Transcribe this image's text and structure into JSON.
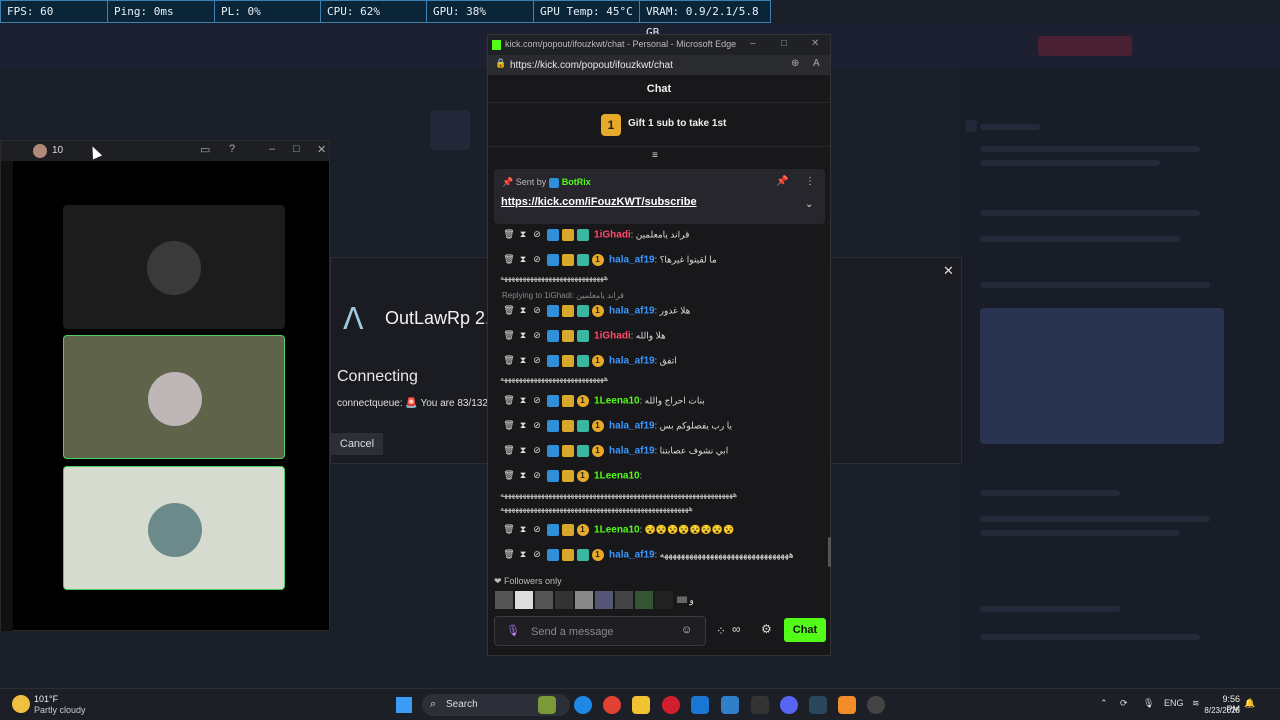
{
  "stats": [
    "FPS: 60",
    "Ping: 0ms",
    "PL: 0%",
    "CPU: 62%",
    "GPU: 38%",
    "GPU Temp: 45°C",
    "VRAM: 0.9/2.1/5.8 GB"
  ],
  "voice": {
    "title": "10"
  },
  "dialog": {
    "title": "OutLawRp 2.",
    "status": "Connecting",
    "queue": "connectqueue: 🚨 You are 83/132",
    "cancel": "Cancel",
    "close": "✕"
  },
  "edge": {
    "window_title": "kick.com/popout/ifouzkwt/chat - Personal - Microsoft Edge",
    "url": "https://kick.com/popout/ifouzkwt/chat",
    "chat_header": "Chat",
    "gift_badge": "1",
    "gift_text": "Gift 1 sub to take 1st",
    "pinned": {
      "sent_by": "Sent by",
      "user": "BotRix",
      "link": "https://kick.com/iFouzKWT/subscribe"
    },
    "messages": [
      {
        "user": "1iGhadi",
        "text": ": قراند يامعلمين"
      },
      {
        "user": "hala_af19",
        "text": ": ما لقيتوا غيرها؟"
      },
      {
        "cont": "ههههههههههههههههههههههههههههه"
      },
      {
        "reply": "Replying to 1iGhadi: قراند يامعلمين"
      },
      {
        "user": "hala_af19",
        "text": ": هلا غدور"
      },
      {
        "user": "1iGhadi",
        "text": ": هلا والله"
      },
      {
        "user": "hala_af19",
        "text": ": اتفق"
      },
      {
        "cont": "ههههههههههههههههههههههههههههه"
      },
      {
        "user": "1Leena10",
        "text": ": بنات احراج والله"
      },
      {
        "user": "hala_af19",
        "text": ": يا رب يفصلوكم بس"
      },
      {
        "user": "hala_af19",
        "text": ": ابي نشوف عصابتنا"
      },
      {
        "user": "1Leena10",
        "text": ":"
      },
      {
        "cont": "هههههههههههههههههههههههههههههههههههههههههههههههههههههههههههههههه"
      },
      {
        "cont": "هههههههههههههههههههههههههههههههههههههههههههههههههههه"
      },
      {
        "user": "1Leena10",
        "text": ": 😵😵😵😵😵😵😵😵"
      },
      {
        "user": "hala_af19",
        "text": ": هههههههههههههههههههههههههههههههه"
      }
    ],
    "followers_only": "Followers only",
    "emote_text": "lllll و",
    "send_placeholder": "Send a message",
    "chat_button": "Chat"
  },
  "taskbar": {
    "temp": "101°F",
    "weather": "Partly cloudy",
    "search": "Search",
    "lang": "ENG",
    "time": "9:56 PM",
    "date": "8/23/2025"
  },
  "colors": {
    "kick_green": "#53fc18",
    "gift_gold": "#e7a92a",
    "stats_border": "#3d7fb0"
  }
}
